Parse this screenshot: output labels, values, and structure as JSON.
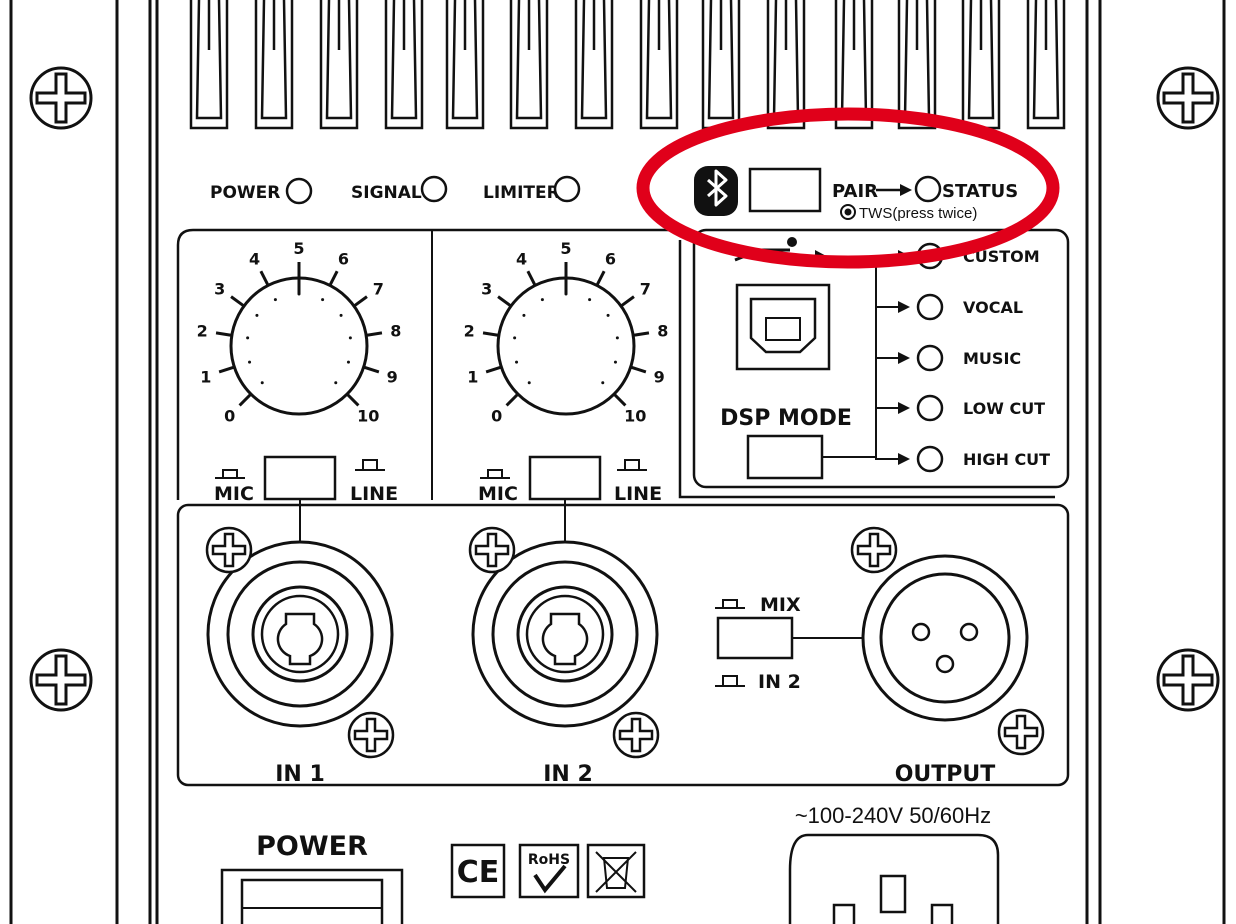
{
  "indicators": {
    "power": "POWER",
    "signal": "SIGNAL",
    "limiter": "LIMITER"
  },
  "bluetooth": {
    "pair": "PAIR",
    "status": "STATUS",
    "tws": "TWS(press twice)"
  },
  "dsp": {
    "title": "DSP MODE",
    "modes": [
      "CUSTOM",
      "VOCAL",
      "MUSIC",
      "LOW CUT",
      "HIGH CUT"
    ]
  },
  "knob_scale": [
    "0",
    "1",
    "2",
    "3",
    "4",
    "5",
    "6",
    "7",
    "8",
    "9",
    "10"
  ],
  "channels": {
    "in1": {
      "label": "IN 1",
      "switch_left": "MIC",
      "switch_right": "LINE"
    },
    "in2": {
      "label": "IN 2",
      "switch_left": "MIC",
      "switch_right": "LINE"
    }
  },
  "output": {
    "label": "OUTPUT",
    "switch_top": "MIX",
    "switch_bottom": "IN 2"
  },
  "power_section": {
    "switch_label": "POWER",
    "voltage": "~100-240V 50/60Hz",
    "cert_ce": "CE",
    "cert_rohs": "RoHS"
  }
}
